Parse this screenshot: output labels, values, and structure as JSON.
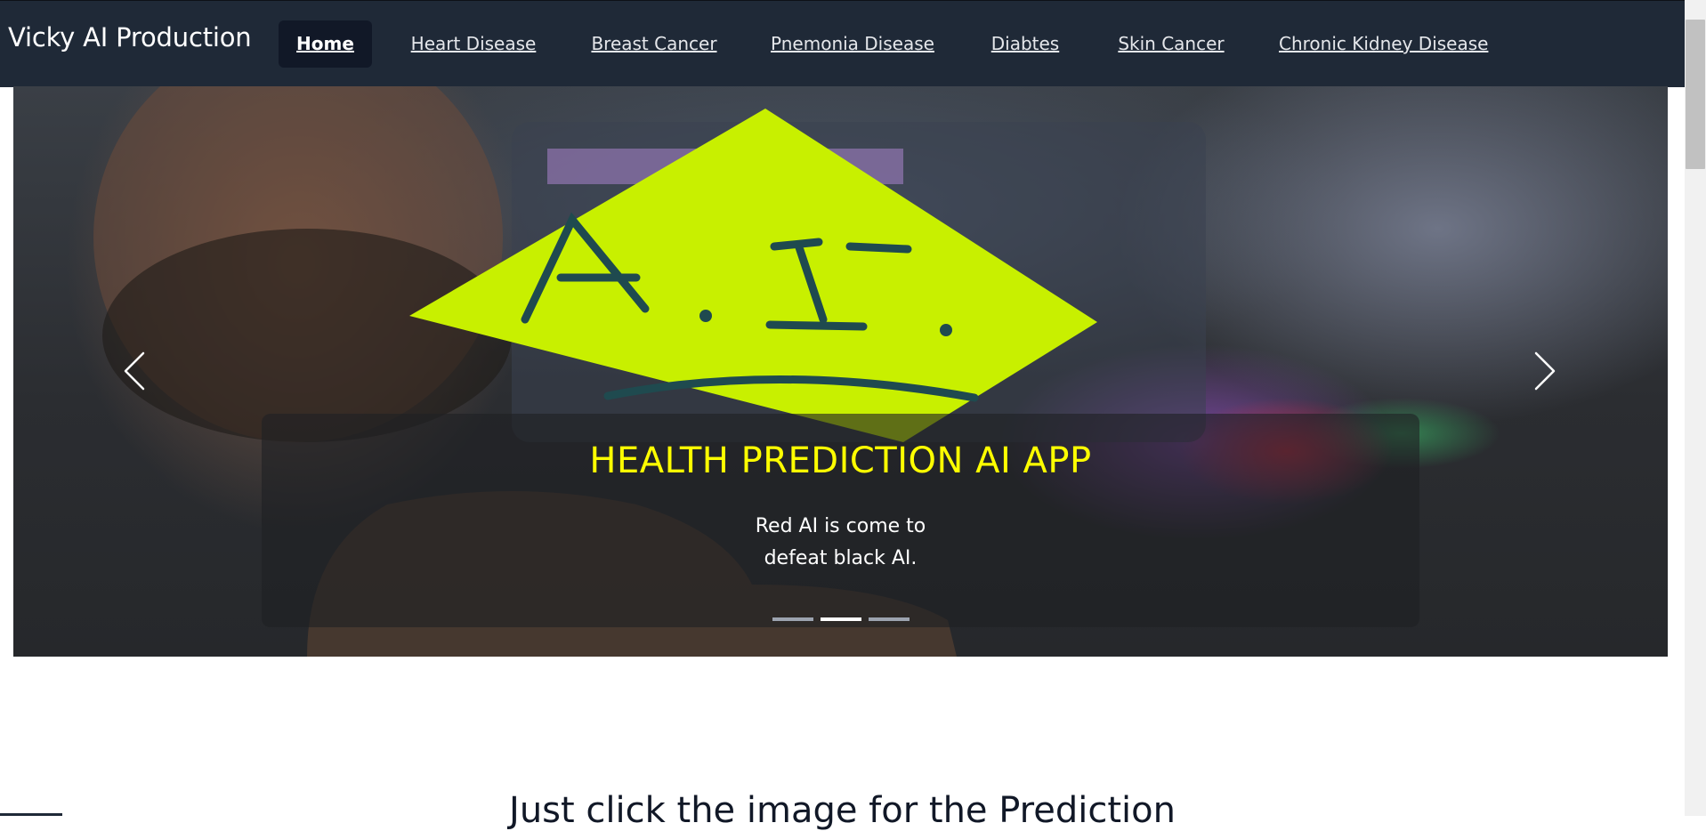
{
  "navbar": {
    "brand": "Vicky AI Production",
    "items": [
      {
        "label": "Home",
        "active": true
      },
      {
        "label": "Heart Disease"
      },
      {
        "label": "Breast Cancer"
      },
      {
        "label": "Pnemonia Disease"
      },
      {
        "label": "Diabtes"
      },
      {
        "label": "Skin Cancer"
      },
      {
        "label": "Chronic Kidney Disease"
      }
    ]
  },
  "carousel": {
    "note_text": "A.I.",
    "caption_title": "HEALTH PREDICTION AI APP",
    "caption_text": "Red AI is come to defeat black AI.",
    "prev_icon": "chevron-left-icon",
    "next_icon": "chevron-right-icon",
    "slide_count": 3,
    "active_slide": 2,
    "note_color": "#c8f000",
    "title_color": "#ffff00"
  },
  "section": {
    "heading": "Just click the image for the Prediction"
  },
  "colors": {
    "navbar_bg": "#1f2937",
    "active_nav_bg": "#111827"
  }
}
